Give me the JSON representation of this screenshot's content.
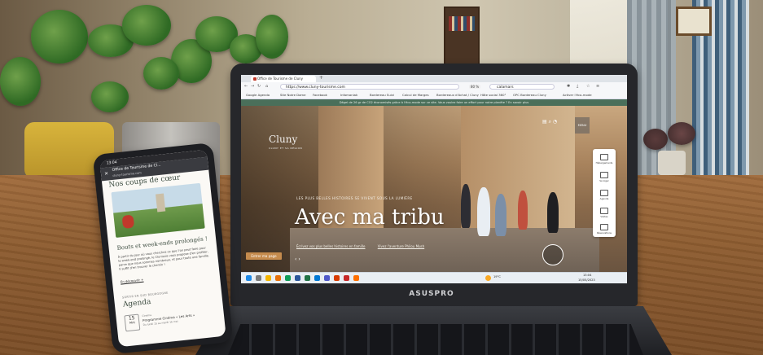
{
  "laptop": {
    "brand": "ASUSPRO",
    "browser": {
      "tab_title": "Office de Tourisme de Cluny",
      "new_tab": "+",
      "url": "https://www.cluny-tourisme.com",
      "zoom": "80 %",
      "search_value": "calamars",
      "bookmarks": [
        "Google Agenda",
        "Site Notre Dame",
        "Facebook",
        "Infomaniak",
        "Bordereau Suivi",
        "Calcul de Marges",
        "Bordereaux d'Achat / Cluny",
        "Hôte social 360°",
        "OPC Bordereau Cluny"
      ],
      "extension_label": "Activer l'éco-mode",
      "info_banner": "Dégel de 26 gr de CO2 économisés grâce à l'éco-mode sur ce site. Vous voulez faire un effort pour notre planète ? En savoir plus"
    },
    "site": {
      "logo": "Cluny",
      "logo_sub": "CLUNY ET SA RÉGION",
      "kicker": "LES PLUS BELLES HISTOIRES SE VIVENT SOUS LA LUMIÈRE",
      "headline": "Avec ma tribu",
      "links": [
        "Écrivez vos plus belles histoires en famille",
        "Vivez l'aventure Philou Mush"
      ],
      "discover_button": "Entrer ma page",
      "menu_label": "MENU",
      "side_panel": [
        "Hébergements",
        "Se loger",
        "Agenda",
        "Visites",
        "Réservations"
      ]
    },
    "taskbar": {
      "weather": "19°C",
      "time": "13:04",
      "date": "15/05/2023"
    }
  },
  "phone": {
    "status_time": "13:04",
    "tab_title": "Office de Tourisme de Cl...",
    "tab_url": "cluny-tourisme.com",
    "section_title": "Nos coups de cœur",
    "card_title": "Bouts et week-ends prolongés !",
    "card_body": "À partir du jour où vous cherchez ce que l'on peut faire pour le week-end prolongé, le Clunisois vous propose d'en profiter, parce que nous sommes nombreux, et pour toute une famille. Il suffit d'en trouver le chemin !",
    "card_link": "En découvrir +",
    "agenda_kicker": "SORTIR EN SUD BOURGOGNE",
    "agenda_title": "Agenda",
    "event_day": "15",
    "event_month": "MAI",
    "event_title": "Programme Cinéma « Les Arts »",
    "event_meta": "Du lundi 15 au mardi 16 mai",
    "event_type": "Cinéma"
  },
  "colors": {
    "accent_green": "#4a6f5a",
    "button_tan": "#c58b4d"
  }
}
